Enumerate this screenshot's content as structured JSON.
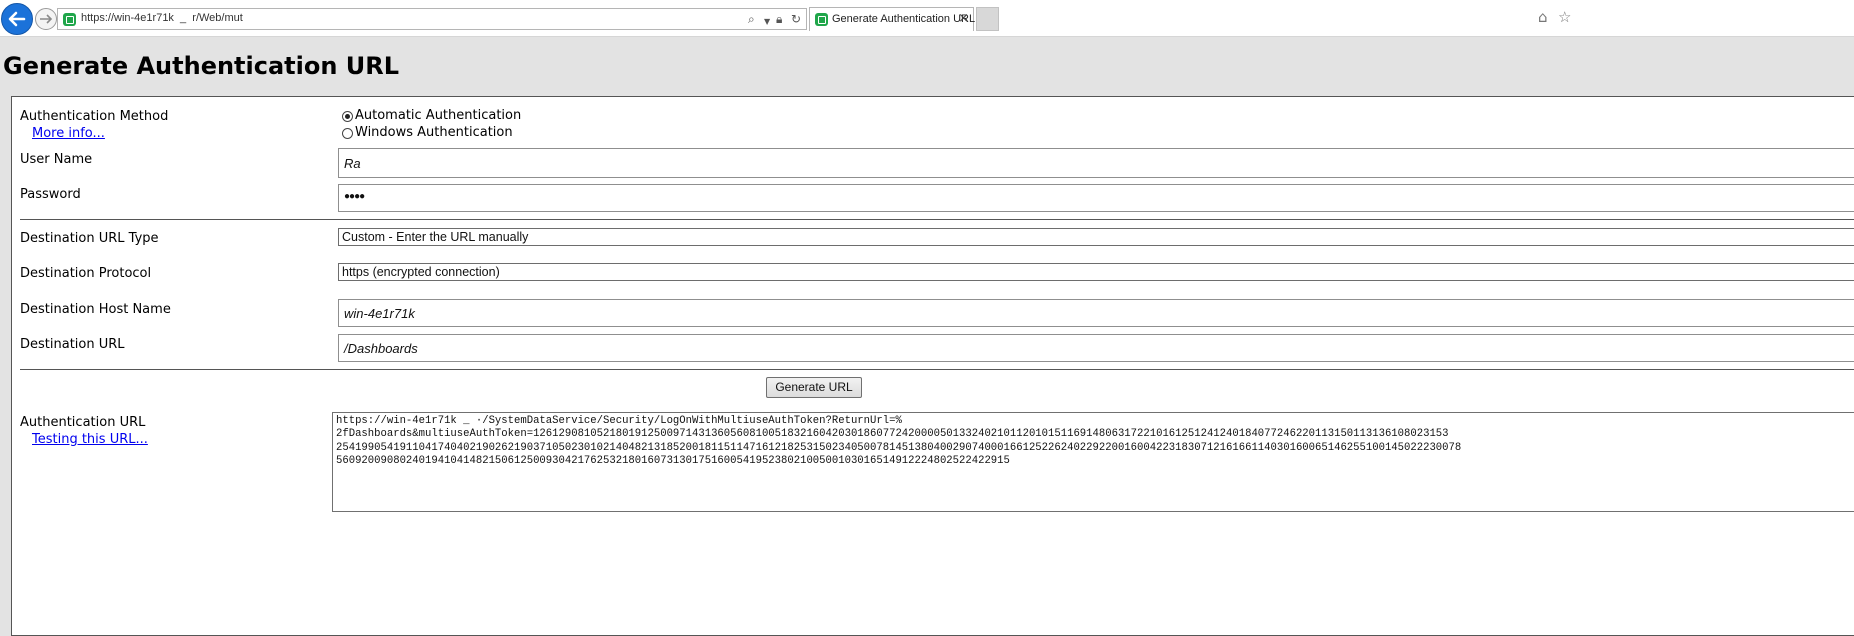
{
  "browser": {
    "address_url": "https://win-4e1r71k  _  r/Web/mut",
    "tab_title": "Generate Authentication URL",
    "tab_close_glyph": "×"
  },
  "page": {
    "title": "Generate Authentication URL"
  },
  "form": {
    "auth_method_label": "Authentication Method",
    "more_info_link": "More info...",
    "auth_options": [
      {
        "label": "Automatic Authentication",
        "selected": true
      },
      {
        "label": "Windows Authentication",
        "selected": false
      }
    ],
    "username_label": "User Name",
    "username_value": "Ra",
    "password_label": "Password",
    "password_value": "●●●●",
    "dest_url_type_label": "Destination URL Type",
    "dest_url_type_value": "Custom - Enter the URL manually",
    "dest_protocol_label": "Destination Protocol",
    "dest_protocol_value": "https (encrypted connection)",
    "dest_host_label": "Destination Host Name",
    "dest_host_value": "win-4e1r71k",
    "dest_url_label": "Destination URL",
    "dest_url_value": "/Dashboards",
    "generate_button": "Generate URL",
    "auth_url_label": "Authentication URL",
    "testing_link": "Testing this URL...",
    "auth_url_lines": [
      "https://win-4e1r71k  _  ·/SystemDataService/Security/LogOnWithMultiuseAuthToken?ReturnUrl=%",
      "2fDashboards&multiuseAuthToken=126129081052180191250097143136056081005183216042030186077242000050133240210112010151169148063172210161251241240184077246220113150113136108023153",
      "254199054191104174040219026219037105023010214048213185200181151147161218253150234050078145138040029074000166125226240229220016004223183071216166114030160065146255100145022230078",
      "5609200908024019410414821506125009304217625321801607313017516005419523802100500103016514912224802522422915"
    ]
  },
  "colors": {
    "page_background": "#e3e3e3",
    "panel_background": "#ffffff",
    "link": "#0000ee",
    "back_button": "#1b72d9",
    "site_icon": "#1fa64a"
  },
  "icons": [
    "back-arrow-icon",
    "forward-arrow-icon",
    "site-favicon-icon",
    "search-icon",
    "dropdown-icon",
    "lock-icon",
    "refresh-icon",
    "close-icon",
    "home-icon",
    "star-icon"
  ]
}
